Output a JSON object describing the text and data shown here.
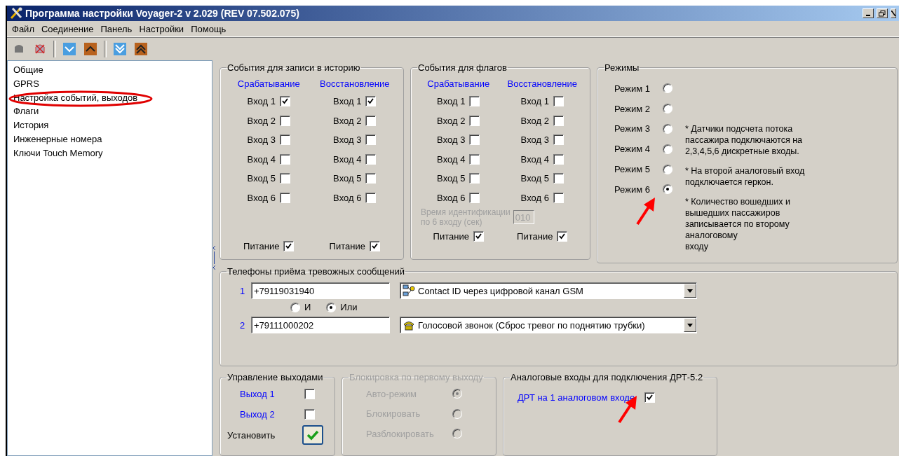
{
  "window": {
    "title": "Программа настройки Voyager-2 v 2.029 (REV 07.502.075)"
  },
  "menu": [
    "Файл",
    "Соединение",
    "Панель",
    "Настройки",
    "Помощь"
  ],
  "sidebar": {
    "items": [
      {
        "label": "Общие"
      },
      {
        "label": "GPRS"
      },
      {
        "label": "Настройка событий, выходов"
      },
      {
        "label": "Флаги"
      },
      {
        "label": "История"
      },
      {
        "label": "Инженерные номера"
      },
      {
        "label": "Ключи Touch Memory"
      }
    ]
  },
  "history_events": {
    "title": "События для записи в историю",
    "columns": [
      {
        "header": "Срабатывание",
        "inputs": [
          {
            "label": "Вход 1",
            "checked": true
          },
          {
            "label": "Вход 2",
            "checked": false
          },
          {
            "label": "Вход 3",
            "checked": false
          },
          {
            "label": "Вход 4",
            "checked": false
          },
          {
            "label": "Вход 5",
            "checked": false
          },
          {
            "label": "Вход 6",
            "checked": false
          }
        ],
        "power": {
          "label": "Питание",
          "checked": true
        }
      },
      {
        "header": "Восстановление",
        "inputs": [
          {
            "label": "Вход 1",
            "checked": true
          },
          {
            "label": "Вход 2",
            "checked": false
          },
          {
            "label": "Вход 3",
            "checked": false
          },
          {
            "label": "Вход 4",
            "checked": false
          },
          {
            "label": "Вход 5",
            "checked": false
          },
          {
            "label": "Вход 6",
            "checked": false
          }
        ],
        "power": {
          "label": "Питание",
          "checked": true
        }
      }
    ]
  },
  "flag_events": {
    "title": "События для флагов",
    "columns": [
      {
        "header": "Срабатывание",
        "inputs": [
          {
            "label": "Вход 1",
            "checked": false
          },
          {
            "label": "Вход 2",
            "checked": false
          },
          {
            "label": "Вход 3",
            "checked": false
          },
          {
            "label": "Вход 4",
            "checked": false
          },
          {
            "label": "Вход 5",
            "checked": false
          },
          {
            "label": "Вход 6",
            "checked": false
          }
        ],
        "power": {
          "label": "Питание",
          "checked": true
        }
      },
      {
        "header": "Восстановление",
        "inputs": [
          {
            "label": "Вход 1",
            "checked": false
          },
          {
            "label": "Вход 2",
            "checked": false
          },
          {
            "label": "Вход 3",
            "checked": false
          },
          {
            "label": "Вход 4",
            "checked": false
          },
          {
            "label": "Вход 5",
            "checked": false
          },
          {
            "label": "Вход 6",
            "checked": false
          }
        ],
        "power": {
          "label": "Питание",
          "checked": true
        }
      }
    ],
    "id_time": {
      "label": "Время идентификации\nпо 6 входу (сек)",
      "value": "010",
      "disabled": true
    }
  },
  "modes": {
    "title": "Режимы",
    "items": [
      {
        "label": "Режим 1",
        "selected": false
      },
      {
        "label": "Режим 2",
        "selected": false
      },
      {
        "label": "Режим 3",
        "selected": false
      },
      {
        "label": "Режим 4",
        "selected": false
      },
      {
        "label": "Режим 5",
        "selected": false
      },
      {
        "label": "Режим 6",
        "selected": true
      }
    ],
    "notes": [
      "* Датчики подсчета потока\nпассажира подключаются на\n2,3,4,5,6 дискретные входы.",
      "* На второй аналоговый вход\nподключается геркон.",
      "* Количество вошедших и\nвышедших пассажиров\nзаписывается по второму\nаналоговому\nвходу"
    ]
  },
  "phones": {
    "title": "Телефоны приёма тревожных сообщений",
    "entries": [
      {
        "index": "1",
        "number": "+79119031940",
        "channel": "Contact ID через цифровой канал GSM",
        "kind": "data"
      },
      {
        "index": "2",
        "number": "+79111000202",
        "channel": "Голосовой звонок (Сброс тревог по поднятию трубки)",
        "kind": "voice"
      }
    ],
    "logic": [
      {
        "label": "И",
        "selected": false
      },
      {
        "label": "Или",
        "selected": true
      }
    ]
  },
  "outputs": {
    "title": "Управление выходами",
    "items": [
      {
        "label": "Выход 1",
        "checked": false
      },
      {
        "label": "Выход 2",
        "checked": false
      }
    ],
    "apply": {
      "label": "Установить"
    }
  },
  "blocking": {
    "title": "Блокировка по первому выходу",
    "disabled": true,
    "options": [
      {
        "label": "Авто-режим",
        "selected": true
      },
      {
        "label": "Блокировать",
        "selected": false
      },
      {
        "label": "Разблокировать",
        "selected": false
      }
    ]
  },
  "analog": {
    "title": "Аналоговые входы для подключения ДРТ-5.2",
    "items": [
      {
        "label": "ДРТ на 1 аналоговом входе",
        "checked": true
      }
    ]
  }
}
